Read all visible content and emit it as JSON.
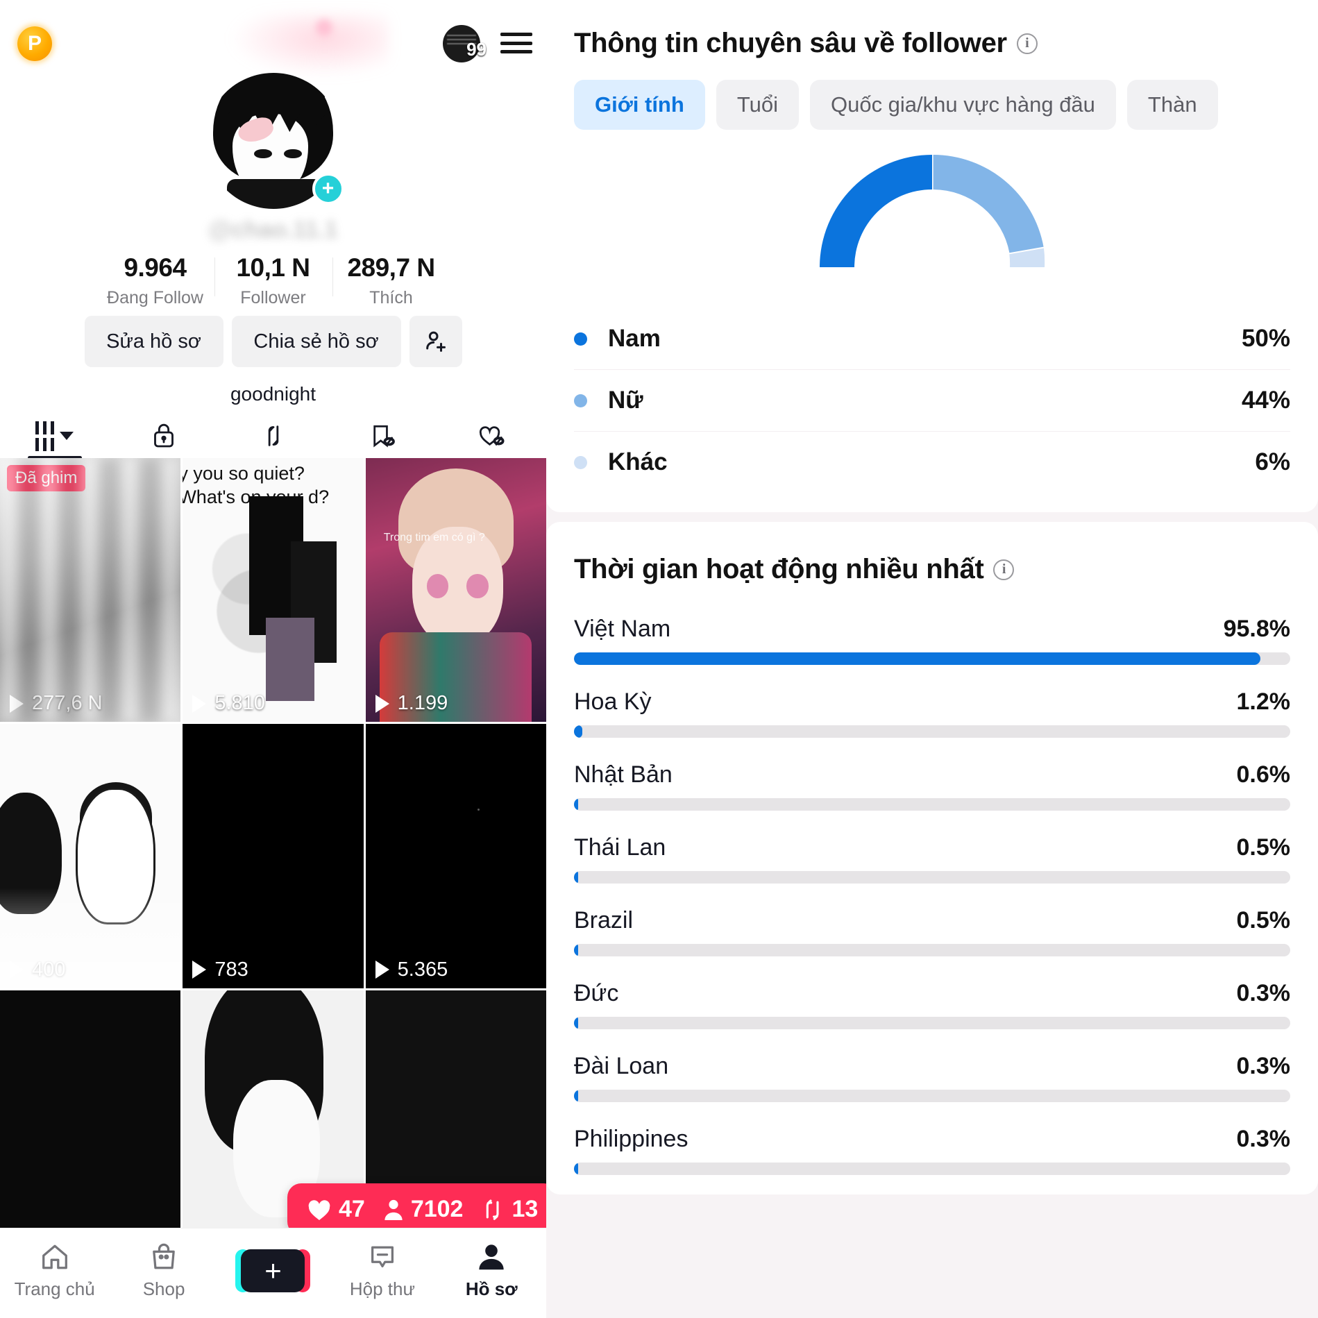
{
  "phone": {
    "header": {
      "pro_badge": "P",
      "coin_count": "99",
      "menu_icon": "hamburger-menu-icon"
    },
    "profile": {
      "handle_blurred": "@chao.11.1",
      "bio": "goodnight",
      "add_friend_icon": "add-person-icon",
      "avatar_plus": "+"
    },
    "stats": [
      {
        "num": "9.964",
        "label": "Đang Follow"
      },
      {
        "num": "10,1 N",
        "label": "Follower"
      },
      {
        "num": "289,7 N",
        "label": "Thích"
      }
    ],
    "actions": {
      "edit": "Sửa hồ sơ",
      "share": "Chia sẻ hồ sơ"
    },
    "tabs": [
      {
        "icon": "grid-videos-icon",
        "active": true
      },
      {
        "icon": "lock-private-icon",
        "active": false
      },
      {
        "icon": "repost-arrows-icon",
        "active": false
      },
      {
        "icon": "bookmark-hidden-icon",
        "active": false
      },
      {
        "icon": "heart-hidden-icon",
        "active": false
      }
    ],
    "videos": [
      {
        "plays": "277,6 N",
        "badge": "Đã ghim"
      },
      {
        "plays": "5.810",
        "caption": "y you so quiet? What's on your d?"
      },
      {
        "plays": "1.199",
        "caption": "Trong tim em có gì ?"
      },
      {
        "plays": "400"
      },
      {
        "plays": "783"
      },
      {
        "plays": "5.365"
      },
      {
        "plays": ""
      },
      {
        "plays": ""
      },
      {
        "plays": ""
      }
    ],
    "float_pill": {
      "likes": "47",
      "viewers": "7102",
      "shares": "13",
      "heart_icon": "heart-icon",
      "person_icon": "person-icon",
      "repost_icon": "repost-icon"
    },
    "bottom_nav": [
      {
        "label": "Trang chủ",
        "icon": "home-icon",
        "active": false
      },
      {
        "label": "Shop",
        "icon": "shop-bag-icon",
        "active": false
      },
      {
        "label": "",
        "icon": "create-plus-icon",
        "active": false
      },
      {
        "label": "Hộp thư",
        "icon": "inbox-message-icon",
        "active": false
      },
      {
        "label": "Hồ sơ",
        "icon": "profile-person-icon",
        "active": true
      }
    ]
  },
  "analytics": {
    "follower_insights": {
      "title": "Thông tin chuyên sâu về follower",
      "info_icon": "info-icon",
      "chips": [
        {
          "label": "Giới tính",
          "active": true
        },
        {
          "label": "Tuổi",
          "active": false
        },
        {
          "label": "Quốc gia/khu vực hàng đầu",
          "active": false
        },
        {
          "label": "Thàn",
          "active": false
        }
      ]
    },
    "top_activity": {
      "title": "Thời gian hoạt động nhiều nhất",
      "info_icon": "info-icon"
    },
    "colors": {
      "primary_blue": "#0b74dd",
      "mid_blue": "#82b5e8",
      "light_blue": "#cfe0f5",
      "track_gray": "#e6e4e6",
      "accent_pink": "#fe2c55"
    }
  },
  "chart_data": [
    {
      "type": "pie",
      "title": "Giới tính",
      "labels": [
        "Nam",
        "Nữ",
        "Khác"
      ],
      "values": [
        50,
        44,
        6
      ],
      "value_labels": [
        "50%",
        "44%",
        "6%"
      ],
      "colors": [
        "#0b74dd",
        "#82b5e8",
        "#cfe0f5"
      ],
      "legend": "bottom",
      "note": "half-donut gauge"
    },
    {
      "type": "bar",
      "title": "Thời gian hoạt động nhiều nhất",
      "orientation": "horizontal",
      "categories": [
        "Việt Nam",
        "Hoa Kỳ",
        "Nhật Bản",
        "Thái Lan",
        "Brazil",
        "Đức",
        "Đài Loan",
        "Philippines"
      ],
      "values": [
        95.8,
        1.2,
        0.6,
        0.5,
        0.5,
        0.3,
        0.3,
        0.3
      ],
      "value_labels": [
        "95.8%",
        "1.2%",
        "0.6%",
        "0.5%",
        "0.5%",
        "0.3%",
        "0.3%",
        "0.3%"
      ],
      "xlabel": "",
      "ylabel": "",
      "xlim": [
        0,
        100
      ],
      "grid": false
    }
  ]
}
